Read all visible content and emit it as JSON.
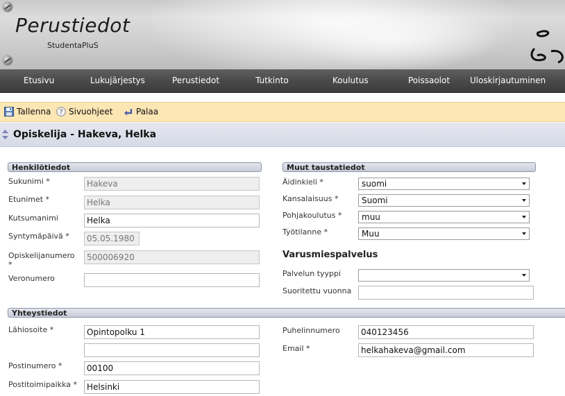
{
  "header": {
    "title": "Perustiedot",
    "subtitle": "StudentaPluS"
  },
  "nav": {
    "items": [
      {
        "label": "Etusivu"
      },
      {
        "label": "Lukujärjestys"
      },
      {
        "label": "Perustiedot"
      },
      {
        "label": "Tutkinto"
      },
      {
        "label": "Koulutus"
      },
      {
        "label": "Poissaolot"
      },
      {
        "label": "Uloskirjautuminen"
      }
    ]
  },
  "toolbar": {
    "save_label": "Tallenna",
    "help_label": "Sivuohjeet",
    "back_label": "Palaa"
  },
  "page": {
    "title": "Opiskelija - Hakeva, Helka"
  },
  "personal": {
    "heading": "Henkilötiedot",
    "surname_label": "Sukunimi *",
    "surname_value": "Hakeva",
    "firstnames_label": "Etunimet *",
    "firstnames_value": "Helka",
    "callname_label": "Kutsumanimi",
    "callname_value": "Helka",
    "birthdate_label": "Syntymäpäivä *",
    "birthdate_value": "05.05.1980",
    "studentno_label": "Opiskelijanumero *",
    "studentno_value": "500006920",
    "taxno_label": "Veronumero",
    "taxno_value": ""
  },
  "background": {
    "heading": "Muut taustatiedot",
    "language_label": "Äidinkieli *",
    "language_value": "suomi",
    "nationality_label": "Kansalaisuus *",
    "nationality_value": "Suomi",
    "education_label": "Pohjakoulutus *",
    "education_value": "muu",
    "employment_label": "Työtilanne *",
    "employment_value": "Muu"
  },
  "military": {
    "heading": "Varusmiespalvelus",
    "type_label": "Palvelun tyyppi",
    "type_value": "",
    "year_label": "Suoritettu vuonna",
    "year_value": ""
  },
  "contact": {
    "heading": "Yhteystiedot",
    "address_label": "Lähiosoite *",
    "address_value": "Opintopolku 1",
    "address2_value": "",
    "postcode_label": "Postinumero *",
    "postcode_value": "00100",
    "city_label": "Postitoimipaikka *",
    "city_value": "Helsinki",
    "phone_label": "Puhelinnumero",
    "phone_value": "040123456",
    "email_label": "Email *",
    "email_value": "helkahakeva@gmail.com"
  }
}
